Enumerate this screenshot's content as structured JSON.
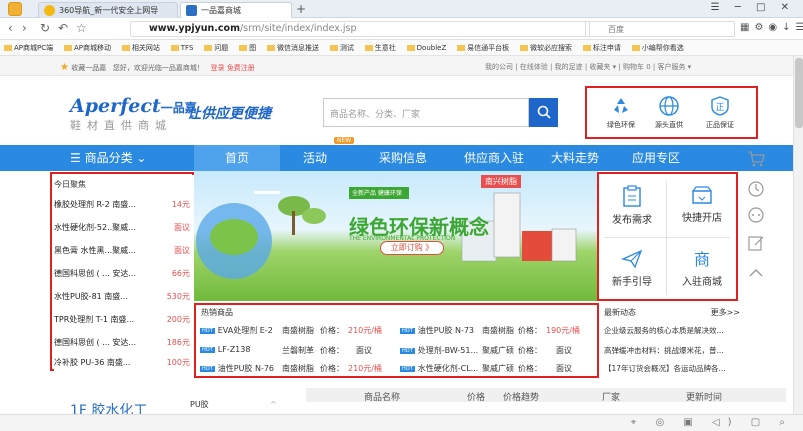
{
  "browser": {
    "tabs": [
      {
        "label": "360导航_新一代安全上网导"
      },
      {
        "label": "一品嘉商城"
      }
    ],
    "url_host": "www.ypjyun.com",
    "url_path": "/srm/site/index/index.jsp",
    "engine": "百度",
    "bookmarks": [
      "AP商城PC端",
      "AP商城移动",
      "相关网站",
      "TFS",
      "问题",
      "图",
      "微信消息推送",
      "测试",
      "生意社",
      "DoubleZ",
      "易信通平台板",
      "微软必应搜索",
      "标注申请",
      "小编帮你看选"
    ]
  },
  "topbar": {
    "favorite": "收藏一品嘉",
    "welcome": "您好，欢迎光临一品嘉商城！",
    "login": "登录",
    "register": "免费注册",
    "links": "我的公司 | 在线体验 | 我的足迹 | 收藏夹 ▾ | 购物车 0 | 客户服务 ▾"
  },
  "header": {
    "logo_en": "Aperfect",
    "logo_cn": "一品嘉",
    "logo_sub": "鞋材直供商城",
    "slogan": "让供应更便捷",
    "search_placeholder": "商品名称、分类、厂家",
    "new_tag": "NEW",
    "features": [
      {
        "label": "绿色环保",
        "icon": "recycle-icon"
      },
      {
        "label": "源头直供",
        "icon": "globe-icon"
      },
      {
        "label": "正品保证",
        "icon": "certified-icon"
      }
    ]
  },
  "nav": {
    "category": "商品分类",
    "items": [
      "首页",
      "活动",
      "采购信息",
      "供应商入驻",
      "大料走势",
      "应用专区"
    ]
  },
  "left_panel": {
    "title": "今日聚焦",
    "products": [
      {
        "name": "橡胶处理剂 R-2 南盛...",
        "price": "14元"
      },
      {
        "name": "水性硬化剂-52..聚威...",
        "price": "面议"
      },
      {
        "name": "黑色膏 水性黑...聚威...",
        "price": "面议"
      },
      {
        "name": "德国科思创 ( ... 安达...",
        "price": "66元"
      },
      {
        "name": "水性PU胶-81 南盛...",
        "price": "530元"
      },
      {
        "name": "TPR处理剂 T-1 南盛...",
        "price": "200元"
      },
      {
        "name": "德国科思创 ( ... 安达...",
        "price": "186元"
      },
      {
        "name": "冷补胶 PU-36 南盛...",
        "price": "100元"
      }
    ]
  },
  "banner": {
    "title": "绿色环保新概念",
    "subtitle": "THE ENVIRONMENTAL PROTECTION",
    "button": "立即订购 》",
    "brand": "南兴树脂",
    "badge": "全新产品 健康环保"
  },
  "quick": {
    "items": [
      {
        "label": "发布需求",
        "icon": "clipboard-icon"
      },
      {
        "label": "快捷开店",
        "icon": "store-icon"
      },
      {
        "label": "新手引导",
        "icon": "paper-plane-icon"
      },
      {
        "label": "入驻商城",
        "icon": "merchant-icon"
      }
    ]
  },
  "hot": {
    "title": "热销商品",
    "rows": [
      [
        {
          "name": "EVA处理剂 E-2",
          "seller": "南盛树脂",
          "price_label": "价格：",
          "price": "210元/桶"
        },
        {
          "name": "油性PU胶 N-73",
          "seller": "南盛树脂",
          "price_label": "价格：",
          "price": "190元/桶"
        }
      ],
      [
        {
          "name": "LF-Z138",
          "seller": "兰磐制革",
          "price_label": "价格：",
          "price": "面议"
        },
        {
          "name": "处理剂-BW-51...",
          "seller": "聚威广硕",
          "price_label": "价格：",
          "price": "面议"
        }
      ],
      [
        {
          "name": "油性PU胶 N-76",
          "seller": "南盛树脂",
          "price_label": "价格：",
          "price": "210元/桶"
        },
        {
          "name": "水性硬化剂-CL...",
          "seller": "聚威广硕",
          "price_label": "价格：",
          "price": "面议"
        }
      ]
    ]
  },
  "news": {
    "title": "最新动态",
    "more": "更多>>",
    "items": [
      "企业级云服务的核心本质是解决效...",
      "高弹缓冲击材料：挑战爆米花，普...",
      "【17年订货会概况】各运动品牌各..."
    ]
  },
  "bottom": {
    "section": "1F 胶水化工",
    "sub": "PU胶",
    "columns": [
      "商品名称",
      "价格",
      "价格趋势",
      "厂家",
      "更新时间"
    ]
  }
}
